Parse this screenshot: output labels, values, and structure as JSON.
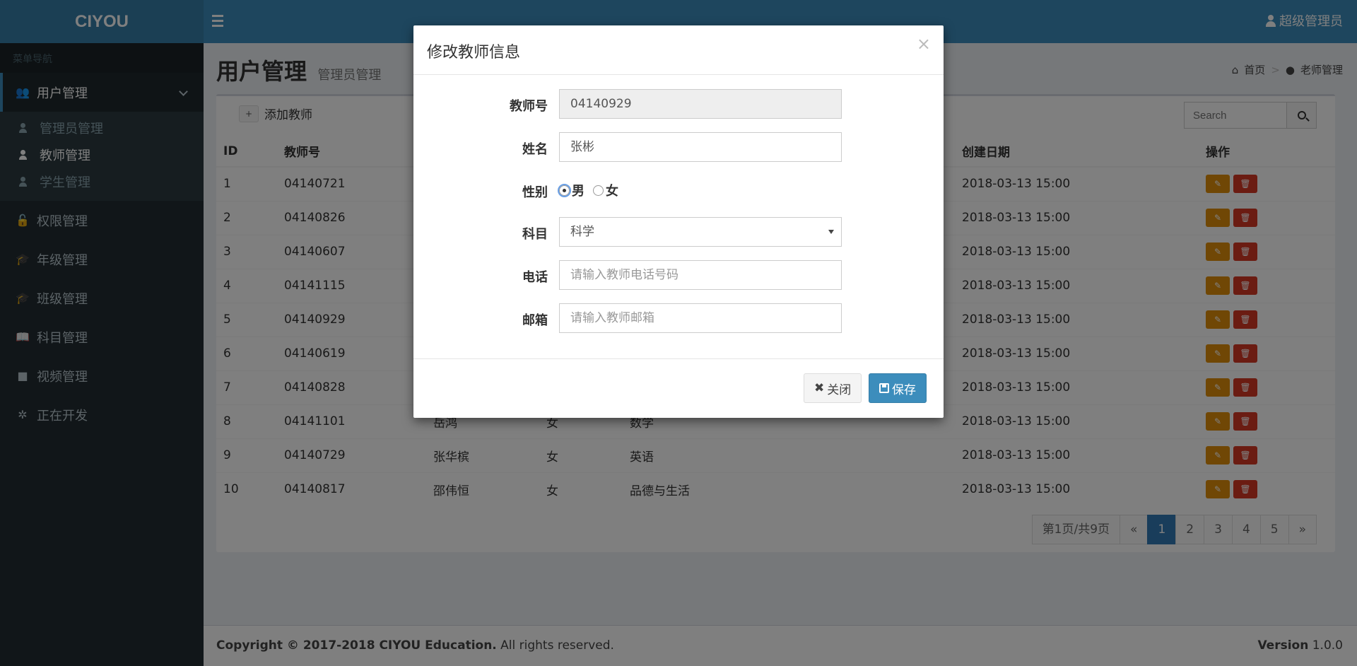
{
  "app": {
    "logo": "CIYOU",
    "user": "超级管理员"
  },
  "sidebar": {
    "header": "菜单导航",
    "items": [
      {
        "label": "用户管理",
        "icon": "users-icon",
        "active": true
      },
      {
        "label": "权限管理",
        "icon": "lock-icon"
      },
      {
        "label": "年级管理",
        "icon": "graduation-cap-icon"
      },
      {
        "label": "班级管理",
        "icon": "graduation-cap-icon"
      },
      {
        "label": "科目管理",
        "icon": "book-icon"
      },
      {
        "label": "视频管理",
        "icon": "video-camera-icon"
      },
      {
        "label": "正在开发",
        "icon": "spinner-icon"
      }
    ],
    "subitems": [
      {
        "label": "管理员管理"
      },
      {
        "label": "教师管理",
        "current": true
      },
      {
        "label": "学生管理"
      }
    ]
  },
  "page": {
    "title": "用户管理",
    "subtitle": "管理员管理"
  },
  "breadcrumb": {
    "home": "首页",
    "current": "老师管理"
  },
  "toolbar": {
    "add_label": "添加教师",
    "search_placeholder": "Search"
  },
  "table": {
    "headers": [
      "ID",
      "教师号",
      "",
      "",
      "",
      "创建日期",
      "操作"
    ],
    "rows": [
      [
        "1",
        "04140721",
        "",
        "",
        "",
        "2018-03-13 15:00"
      ],
      [
        "2",
        "04140826",
        "",
        "",
        "",
        "2018-03-13 15:00"
      ],
      [
        "3",
        "04140607",
        "",
        "",
        "",
        "2018-03-13 15:00"
      ],
      [
        "4",
        "04141115",
        "",
        "",
        "",
        "2018-03-13 15:00"
      ],
      [
        "5",
        "04140929",
        "",
        "",
        "",
        "2018-03-13 15:00"
      ],
      [
        "6",
        "04140619",
        "",
        "",
        "",
        "2018-03-13 15:00"
      ],
      [
        "7",
        "04140828",
        "",
        "",
        "",
        "2018-03-13 15:00"
      ],
      [
        "8",
        "04141101",
        "岳鸿",
        "女",
        "数学",
        "2018-03-13 15:00"
      ],
      [
        "9",
        "04140729",
        "张华槟",
        "女",
        "英语",
        "2018-03-13 15:00"
      ],
      [
        "10",
        "04140817",
        "邵伟恒",
        "女",
        "品德与生活",
        "2018-03-13 15:00"
      ]
    ]
  },
  "pager": {
    "info": "第1页/共9页",
    "prev": "«",
    "pages": [
      "1",
      "2",
      "3",
      "4",
      "5"
    ],
    "next": "»"
  },
  "footer": {
    "copyright_bold": "Copyright © 2017-2018 CIYOU Education.",
    "copyright_rest": " All rights reserved.",
    "version_label": "Version",
    "version": "1.0.0"
  },
  "modal": {
    "title": "修改教师信息",
    "close_glyph": "×",
    "fields": {
      "teacher_no": {
        "label": "教师号",
        "value": "04140929"
      },
      "name": {
        "label": "姓名",
        "value": "张彬"
      },
      "gender": {
        "label": "性别",
        "male": "男",
        "female": "女",
        "selected": "男"
      },
      "subject": {
        "label": "科目",
        "value": "科学"
      },
      "phone": {
        "label": "电话",
        "placeholder": "请输入教师电话号码"
      },
      "email": {
        "label": "邮箱",
        "placeholder": "请输入教师邮箱"
      }
    },
    "close_label": "关闭",
    "save_label": "保存"
  },
  "colors": {
    "header": "#3c8dbc",
    "sidebar": "#222d32",
    "edit": "#e08e0b",
    "delete": "#d73925",
    "primary": "#3c8dbc"
  }
}
